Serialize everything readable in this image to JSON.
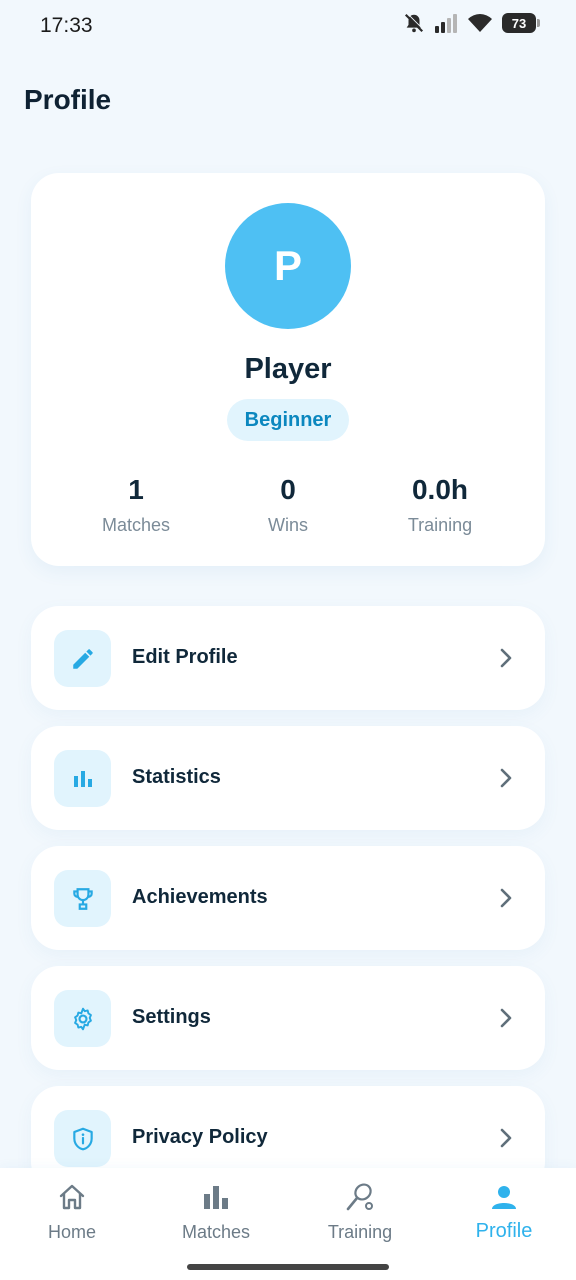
{
  "status_bar": {
    "time": "17:33",
    "battery": "73"
  },
  "page": {
    "title": "Profile"
  },
  "profile": {
    "avatar_initial": "P",
    "name": "Player",
    "level": "Beginner",
    "stats": [
      {
        "value": "1",
        "label": "Matches"
      },
      {
        "value": "0",
        "label": "Wins"
      },
      {
        "value": "0.0h",
        "label": "Training"
      }
    ]
  },
  "menu": [
    {
      "label": "Edit Profile",
      "icon": "pencil-icon"
    },
    {
      "label": "Statistics",
      "icon": "bar-chart-icon"
    },
    {
      "label": "Achievements",
      "icon": "trophy-icon"
    },
    {
      "label": "Settings",
      "icon": "gear-icon"
    },
    {
      "label": "Privacy Policy",
      "icon": "shield-info-icon"
    }
  ],
  "nav": [
    {
      "label": "Home",
      "icon": "home-icon"
    },
    {
      "label": "Matches",
      "icon": "bar-chart-icon"
    },
    {
      "label": "Training",
      "icon": "racket-icon"
    },
    {
      "label": "Profile",
      "icon": "person-icon",
      "active": true
    }
  ],
  "colors": {
    "accent": "#4ec0f3",
    "active_nav": "#2fb2ec",
    "badge_bg": "#e1f4fd",
    "badge_text": "#0b87bf"
  }
}
